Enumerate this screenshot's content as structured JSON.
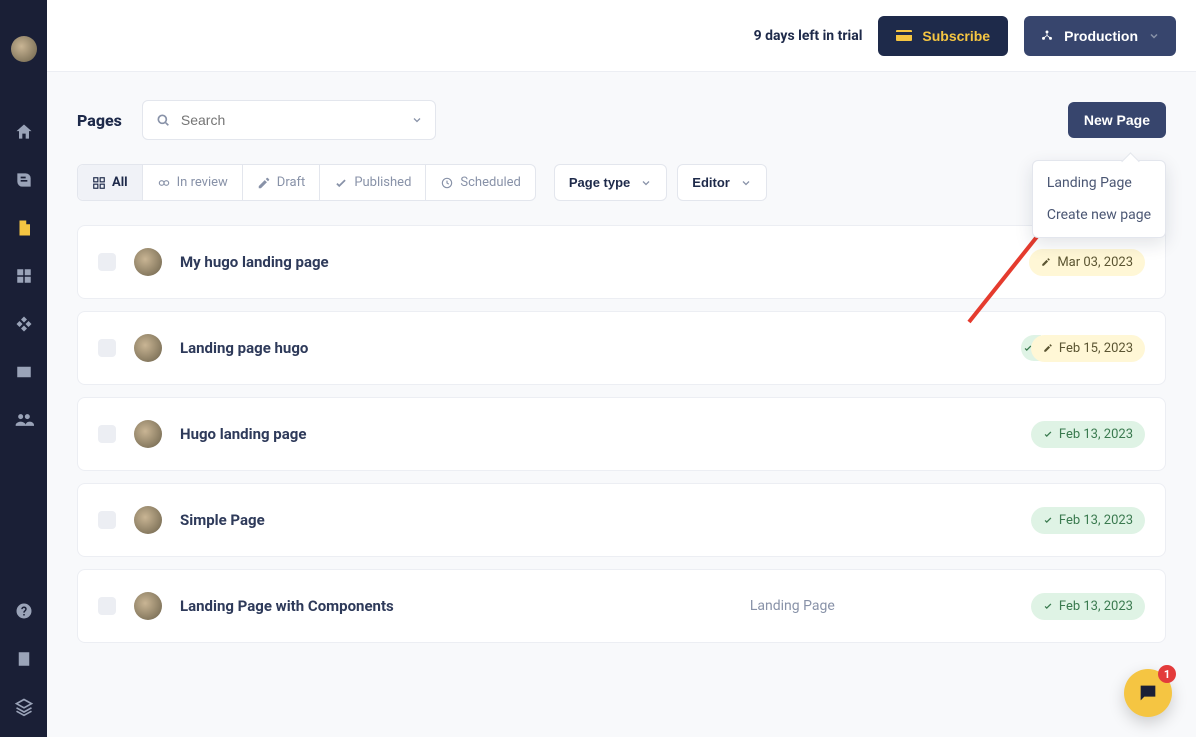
{
  "topbar": {
    "trial_text": "9 days left in trial",
    "subscribe_label": "Subscribe",
    "production_label": "Production"
  },
  "page": {
    "title": "Pages",
    "search_placeholder": "Search",
    "new_page_label": "New Page"
  },
  "new_page_menu": {
    "items": [
      "Landing Page",
      "Create new page"
    ]
  },
  "filters": {
    "segments": [
      {
        "label": "All",
        "icon": "grid"
      },
      {
        "label": "In review",
        "icon": "eyes"
      },
      {
        "label": "Draft",
        "icon": "pencil"
      },
      {
        "label": "Published",
        "icon": "check"
      },
      {
        "label": "Scheduled",
        "icon": "clock"
      }
    ],
    "page_type_label": "Page type",
    "editor_label": "Editor"
  },
  "rows": [
    {
      "title": "My hugo landing page",
      "type": "",
      "status": "draft",
      "date": "Mar 03, 2023",
      "leadGreen": false
    },
    {
      "title": "Landing page hugo",
      "type": "",
      "status": "draft",
      "date": "Feb 15, 2023",
      "leadGreen": true
    },
    {
      "title": "Hugo landing page",
      "type": "",
      "status": "published",
      "date": "Feb 13, 2023",
      "leadGreen": false
    },
    {
      "title": "Simple Page",
      "type": "",
      "status": "published",
      "date": "Feb 13, 2023",
      "leadGreen": false
    },
    {
      "title": "Landing Page with Components",
      "type": "Landing Page",
      "status": "published",
      "date": "Feb 13, 2023",
      "leadGreen": false
    }
  ],
  "chat": {
    "unread": "1"
  }
}
